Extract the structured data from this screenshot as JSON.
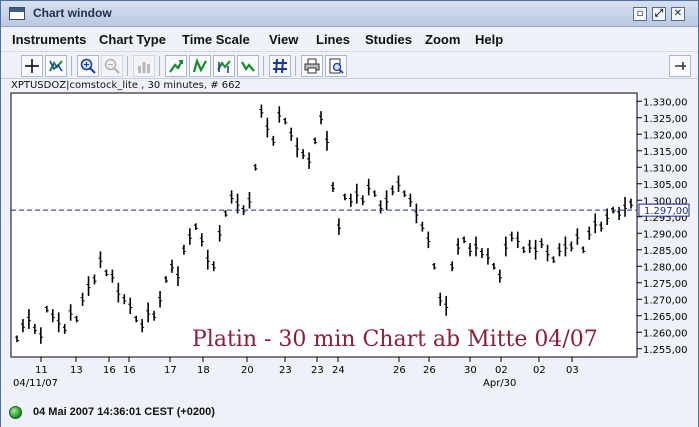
{
  "window": {
    "title": "Chart window",
    "buttons": [
      "restore-icon",
      "maximize-icon",
      "close-icon"
    ]
  },
  "menu": [
    "Instruments",
    "Chart Type",
    "Time Scale",
    "View",
    "Lines",
    "Studies",
    "Zoom",
    "Help"
  ],
  "toolbar": {
    "icons": [
      "crosshair-icon",
      "trend-tool-icon",
      "zoom-in-icon",
      "zoom-out-icon",
      "bar-chart-icon",
      "chart-up-icon",
      "chart-updown-icon",
      "chart-split-icon",
      "chart-flip-icon",
      "hash-grid-icon",
      "print-icon",
      "print-preview-icon",
      "pin-icon"
    ]
  },
  "symbol_line": "XPTUSDOZ|comstock_lite , 30 minutes, # 662",
  "status": {
    "text": "04 Mai 2007 14:36:01 CEST (+0200)"
  },
  "colors": {
    "frame": "#4f6f9f",
    "dashed_line": "#1a2a9a",
    "annotation": "#8b1f38",
    "bars": "#000000"
  },
  "chart_data": {
    "type": "bar",
    "annotation": "Platin - 30 min Chart ab Mitte 04/07",
    "ylim": [
      1252.5,
      1332.5
    ],
    "y_ticks": [
      "1.330,00",
      "1.325,00",
      "1.320,00",
      "1.315,00",
      "1.310,00",
      "1.305,00",
      "1.300,00",
      "1.295,00",
      "1.290,00",
      "1.285,00",
      "1.280,00",
      "1.275,00",
      "1.270,00",
      "1.265,00",
      "1.260,00",
      "1.255,00"
    ],
    "current_price_label": "1.297,00",
    "current_price": 1297.0,
    "x_tick_labels": [
      "11",
      "13",
      "16",
      "16",
      "17",
      "18",
      "20",
      "23",
      "23",
      "24",
      "26",
      "26",
      "30",
      "02",
      "02",
      "03"
    ],
    "x_subticks": [
      "04/11/07",
      "Apr/30"
    ],
    "series": [
      {
        "values": [
          1258,
          1262,
          1264,
          1261,
          1259,
          1267,
          1265,
          1263,
          1261,
          1266,
          1264,
          1270,
          1274,
          1276,
          1282,
          1278,
          1277,
          1272,
          1270,
          1268,
          1264,
          1262,
          1266,
          1265,
          1270,
          1276,
          1280,
          1277,
          1285,
          1289,
          1292,
          1288,
          1282,
          1280,
          1290,
          1296,
          1301,
          1299,
          1297,
          1300,
          1310,
          1327,
          1322,
          1318,
          1326,
          1324,
          1320,
          1316,
          1314,
          1312,
          1318,
          1325,
          1318,
          1304,
          1292,
          1301,
          1300,
          1302,
          1300,
          1304,
          1302,
          1298,
          1300,
          1303,
          1305,
          1302,
          1300,
          1296,
          1292,
          1288,
          1280,
          1270,
          1268,
          1280,
          1286,
          1288,
          1285,
          1286,
          1284,
          1283,
          1280,
          1277,
          1286,
          1289,
          1288,
          1285,
          1286,
          1285,
          1287,
          1284,
          1282,
          1285,
          1286,
          1286,
          1289,
          1285,
          1290,
          1293,
          1292,
          1295,
          1297,
          1296,
          1298,
          1299
        ]
      }
    ]
  }
}
